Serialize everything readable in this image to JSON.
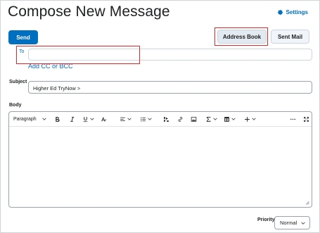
{
  "page": {
    "title": "Compose New Message",
    "settings_label": "Settings"
  },
  "actions": {
    "send": "Send",
    "address_book": "Address Book",
    "sent_mail": "Sent Mail"
  },
  "to": {
    "label": "To",
    "value": ""
  },
  "add_cc_bcc": "Add CC or BCC",
  "subject": {
    "label": "Subject",
    "value": "Higher Ed TryNow >"
  },
  "body": {
    "label": "Body",
    "paragraph_style": "Paragraph",
    "content": ""
  },
  "toolbar_icons": [
    "bold-icon",
    "italic-icon",
    "underline-icon",
    "font-style-icon",
    "align-icon",
    "list-icon",
    "insert-media-icon",
    "link-icon",
    "image-icon",
    "equation-icon",
    "table-icon",
    "add-icon",
    "more-icon",
    "fullscreen-icon"
  ],
  "priority": {
    "label": "Priority",
    "value": "Normal"
  },
  "colors": {
    "accent": "#006fbf",
    "highlight": "#e0272a",
    "address_book_bg": "#e3e9f1"
  }
}
